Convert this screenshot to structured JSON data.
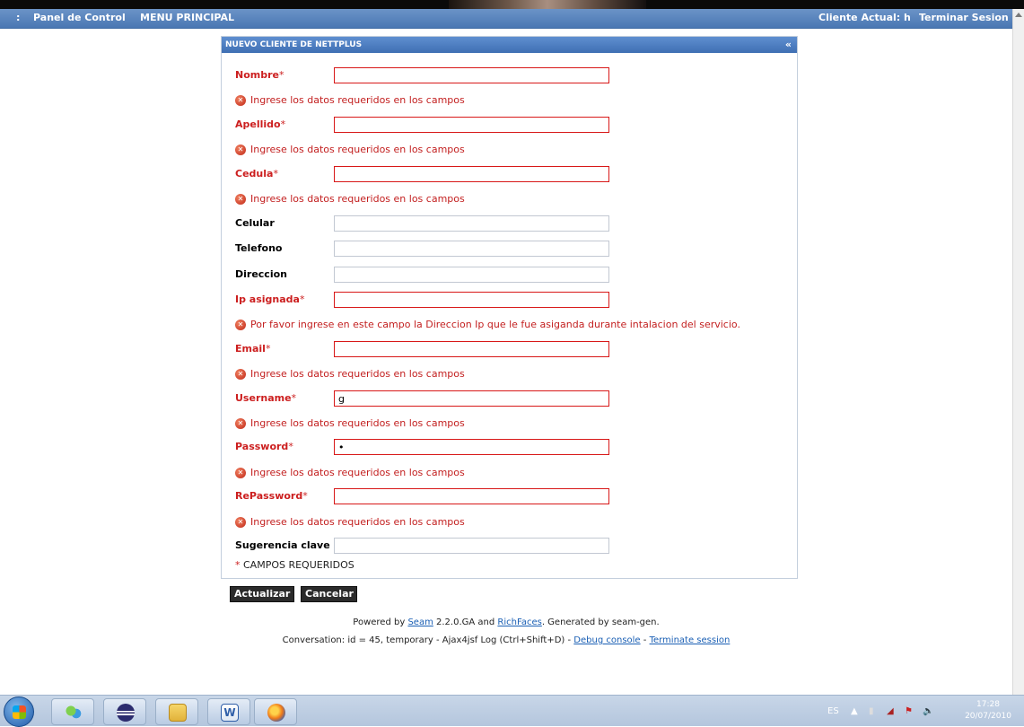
{
  "menubar": {
    "colon": ":",
    "panel_control": "Panel de Control",
    "main_menu": "MENU PRINCIPAL",
    "current_client": "Cliente Actual: h",
    "end_session": "Terminar Sesion"
  },
  "panel": {
    "title": "NUEVO CLIENTE DE NETTPLUS",
    "collapse": "«"
  },
  "form": {
    "required_star": "*",
    "fields": {
      "nombre": {
        "label": "Nombre",
        "value": ""
      },
      "apellido": {
        "label": "Apellido",
        "value": ""
      },
      "cedula": {
        "label": "Cedula",
        "value": ""
      },
      "celular": {
        "label": "Celular",
        "value": ""
      },
      "telefono": {
        "label": "Telefono",
        "value": ""
      },
      "direccion": {
        "label": "Direccion",
        "value": ""
      },
      "ip": {
        "label": "Ip asignada",
        "value": ""
      },
      "email": {
        "label": "Email",
        "value": ""
      },
      "username": {
        "label": "Username",
        "value": "g"
      },
      "password": {
        "label": "Password",
        "value": "•"
      },
      "repassword": {
        "label": "RePassword",
        "value": ""
      },
      "sugerencia": {
        "label": "Sugerencia clave",
        "value": ""
      }
    },
    "errors": {
      "required": "Ingrese los datos requeridos en los campos",
      "ip": "Por favor ingrese en este campo la Direccion Ip que le fue asiganda durante intalacion del servicio."
    },
    "required_note": "CAMPOS REQUERIDOS"
  },
  "buttons": {
    "update": "Actualizar",
    "cancel": "Cancelar"
  },
  "footer": {
    "powered_prefix": "Powered by",
    "seam": "Seam",
    "seam_version": "2.2.0.GA and",
    "richfaces": "RichFaces",
    "generated": ". Generated by seam-gen.",
    "conversation": "Conversation: id = 45, temporary - Ajax4jsf Log (Ctrl+Shift+D) -",
    "debug_console": "Debug console",
    "separator": "-",
    "terminate": "Terminate session"
  },
  "taskbar": {
    "lang": "ES",
    "time": "17:28",
    "date": "20/07/2010",
    "apps": [
      "start-orb",
      "messenger-icon",
      "eclipse-icon",
      "explorer-icon",
      "word-icon",
      "firefox-icon"
    ]
  }
}
